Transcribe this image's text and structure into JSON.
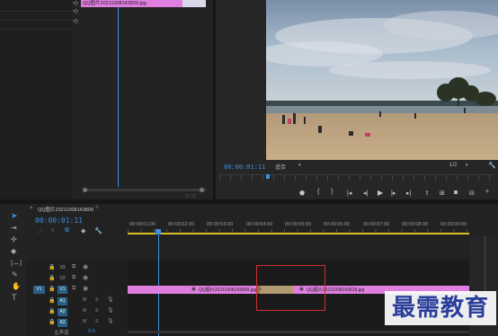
{
  "source_panel": {
    "clip_name": "QQ图片20211008143809.jpg"
  },
  "program_monitor": {
    "timecode": "00:00:01:11",
    "fit_select": "适合",
    "quality_select": "1/2"
  },
  "timeline": {
    "sequence_name": "QQ图片20211008143809",
    "timecode": "00:00:01:11",
    "ruler_ticks": [
      "00:00:01:00",
      "00:00:02:00",
      "00:00:03:00",
      "00:00:04:00",
      "00:00:05:00",
      "00:00:06:00",
      "00:00:07:00",
      "00:00:08:00",
      "00:00:09:00"
    ],
    "tracks": {
      "video": [
        "V3",
        "V2",
        "V1"
      ],
      "audio": [
        "A1",
        "A2",
        "A3"
      ],
      "master_label": "主声道",
      "master_value": "0.0"
    },
    "clip1_label": "QQ图片20211008143809.jpg",
    "clip2_label": "QQ图片20211008143818.jpg",
    "transition_marker": "fx"
  },
  "watermark": "最需教育",
  "colors": {
    "timecode_blue": "#3d8fe0",
    "clip_pink": "#e07ee0",
    "selection_red": "#d03030",
    "work_area_yellow": "#d8c020"
  }
}
